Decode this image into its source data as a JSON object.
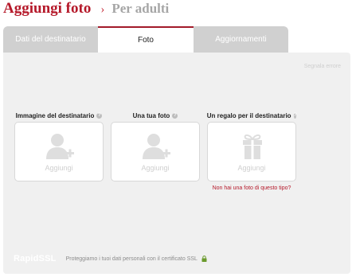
{
  "header": {
    "title": "Aggiungi foto",
    "separator": "›",
    "subtitle": "Per adulti"
  },
  "tabs": [
    {
      "label": "Dati del destinatario",
      "active": false
    },
    {
      "label": "Foto",
      "active": true
    },
    {
      "label": "Aggiornamenti",
      "active": false
    }
  ],
  "panel": {
    "report_label": "Segnala errore",
    "columns": [
      {
        "label": "Immagine del destinatario",
        "add_label": "Aggiungi",
        "icon": "person-add-icon"
      },
      {
        "label": "Una tua foto",
        "add_label": "Aggiungi",
        "icon": "person-add-icon"
      },
      {
        "label": "Un regalo per il destinatario",
        "add_label": "Aggiungi",
        "icon": "gift-icon"
      }
    ],
    "no_photo_link": "Non hai una foto di questo tipo?"
  },
  "footer": {
    "ssl_logo": "RapidSSL",
    "text": "Proteggiamo i tuoi dati personali con il certificato SSL",
    "lock_icon": "lock-icon"
  },
  "colors": {
    "accent": "#b5192a",
    "tab_inactive": "#d0d0d0",
    "panel_bg": "#f0f0f0",
    "lock": "#6a9a2c"
  }
}
